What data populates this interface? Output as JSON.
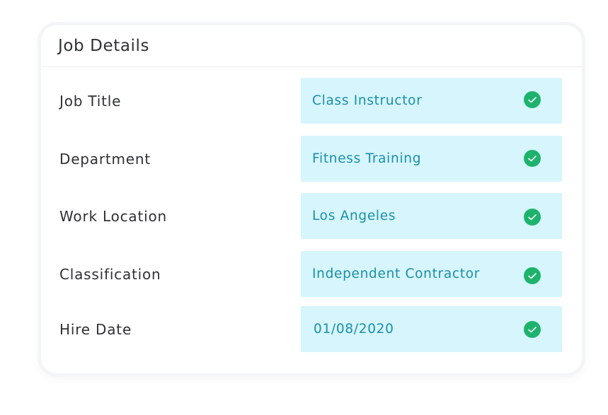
{
  "card": {
    "title": "Job Details"
  },
  "rows": [
    {
      "label": "Job Title",
      "value": "Class Instructor",
      "status_icon": "check-circle-icon"
    },
    {
      "label": "Department",
      "value": "Fitness Training",
      "status_icon": "check-circle-icon"
    },
    {
      "label": "Work Location",
      "value": "Los Angeles",
      "status_icon": "check-circle-icon"
    },
    {
      "label": "Classification",
      "value": "Independent Contractor",
      "status_icon": "check-circle-icon"
    },
    {
      "label": "Hire Date",
      "value": "01/08/2020",
      "status_icon": "check-circle-icon"
    }
  ],
  "colors": {
    "field_background": "#d6f5fd",
    "field_text": "#1a8fa8",
    "check_green": "#1db36d",
    "label_text": "#2f3133"
  }
}
